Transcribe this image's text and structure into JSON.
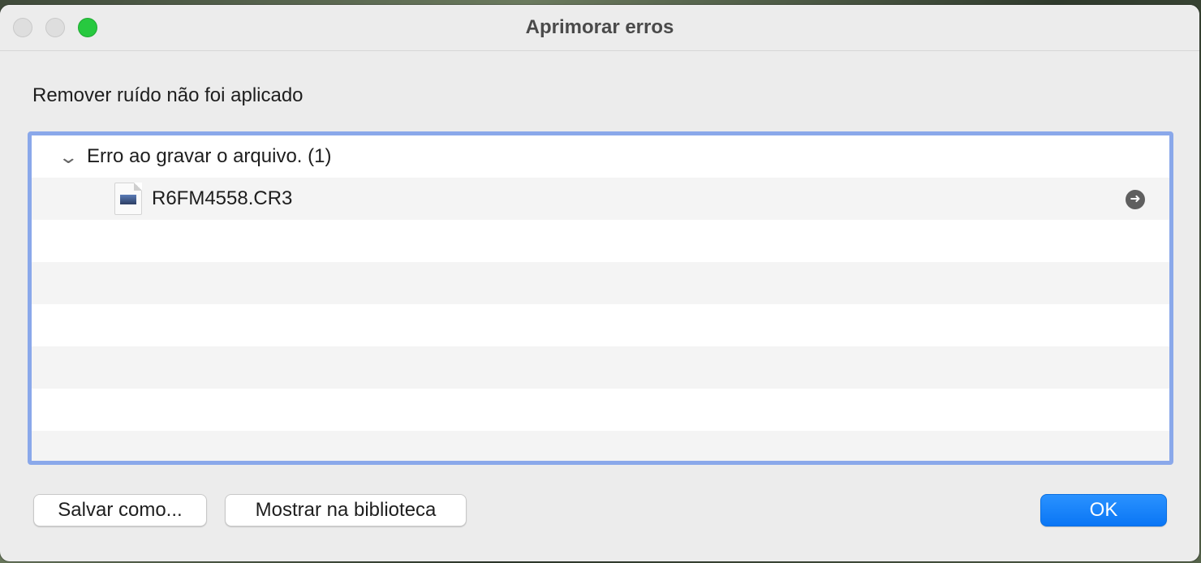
{
  "window": {
    "title": "Aprimorar erros"
  },
  "message": "Remover ruído não foi aplicado",
  "list": {
    "group_label": "Erro ao gravar o arquivo. (1)",
    "files": [
      {
        "name": "R6FM4558.CR3",
        "icon": "raw-image-file-icon"
      }
    ]
  },
  "buttons": {
    "save_as": "Salvar como...",
    "show_in_library": "Mostrar na biblioteca",
    "ok": "OK"
  },
  "colors": {
    "accent": "#0a76f5",
    "focus_ring": "#8aa8ea",
    "zoom": "#27c93f"
  },
  "icons": {
    "disclosure": "chevron-down-icon",
    "reveal": "arrow-right-circle-icon"
  }
}
